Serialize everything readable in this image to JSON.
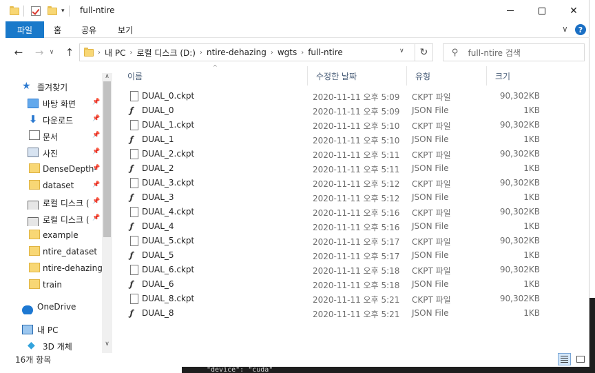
{
  "window": {
    "title": "full-ntire",
    "minimize_icon": "minimize-icon",
    "maximize_icon": "maximize-icon",
    "close_glyph": "✕"
  },
  "ribbon": {
    "tabs": [
      "파일",
      "홈",
      "공유",
      "보기"
    ],
    "expand_glyph": "∨",
    "help_glyph": "?"
  },
  "address": {
    "back_glyph": "←",
    "forward_glyph": "→",
    "recent_glyph": "∨",
    "up_glyph": "↑",
    "crumbs": [
      "내 PC",
      "로컬 디스크 (D:)",
      "ntire-dehazing",
      "wgts",
      "full-ntire"
    ],
    "sep": "›",
    "dropdown_glyph": "∨",
    "refresh_glyph": "↻"
  },
  "search": {
    "placeholder": "full-ntire 검색",
    "icon_glyph": "⚲"
  },
  "nav": {
    "items": [
      {
        "label": "즐겨찾기",
        "icon": "star-icon"
      },
      {
        "label": "바탕 화면",
        "icon": "desktop-icon",
        "pinned": true
      },
      {
        "label": "다운로드",
        "icon": "download-icon",
        "pinned": true
      },
      {
        "label": "문서",
        "icon": "document-icon",
        "pinned": true
      },
      {
        "label": "사진",
        "icon": "pictures-icon",
        "pinned": true
      },
      {
        "label": "DenseDepth-",
        "icon": "folder-icon",
        "pinned": true
      },
      {
        "label": "dataset",
        "icon": "folder-icon",
        "pinned": true
      },
      {
        "label": "로컬 디스크 (",
        "icon": "drive-icon",
        "pinned": true
      },
      {
        "label": "로컬 디스크 (",
        "icon": "drive-icon",
        "pinned": true
      },
      {
        "label": "example",
        "icon": "folder-icon"
      },
      {
        "label": "ntire_dataset",
        "icon": "folder-icon"
      },
      {
        "label": "ntire-dehazing",
        "icon": "folder-icon"
      },
      {
        "label": "train",
        "icon": "folder-icon"
      },
      {
        "label": "OneDrive",
        "icon": "cloud-icon"
      },
      {
        "label": "내 PC",
        "icon": "computer-icon"
      },
      {
        "label": "3D 개체",
        "icon": "cube-icon"
      }
    ],
    "pin_glyph": "📌",
    "scroll_up_glyph": "∧",
    "scroll_down_glyph": "∨"
  },
  "columns": {
    "name": "이름",
    "date": "수정한 날짜",
    "type": "유형",
    "size": "크기",
    "sort_glyph": "^"
  },
  "files": [
    {
      "name": "DUAL_0.ckpt",
      "date": "2020-11-11 오후 5:09",
      "type": "CKPT 파일",
      "size": "90,302KB",
      "icon": "file-icon"
    },
    {
      "name": "DUAL_0",
      "date": "2020-11-11 오후 5:09",
      "type": "JSON File",
      "size": "1KB",
      "icon": "json-file-icon"
    },
    {
      "name": "DUAL_1.ckpt",
      "date": "2020-11-11 오후 5:10",
      "type": "CKPT 파일",
      "size": "90,302KB",
      "icon": "file-icon"
    },
    {
      "name": "DUAL_1",
      "date": "2020-11-11 오후 5:10",
      "type": "JSON File",
      "size": "1KB",
      "icon": "json-file-icon"
    },
    {
      "name": "DUAL_2.ckpt",
      "date": "2020-11-11 오후 5:11",
      "type": "CKPT 파일",
      "size": "90,302KB",
      "icon": "file-icon"
    },
    {
      "name": "DUAL_2",
      "date": "2020-11-11 오후 5:11",
      "type": "JSON File",
      "size": "1KB",
      "icon": "json-file-icon"
    },
    {
      "name": "DUAL_3.ckpt",
      "date": "2020-11-11 오후 5:12",
      "type": "CKPT 파일",
      "size": "90,302KB",
      "icon": "file-icon"
    },
    {
      "name": "DUAL_3",
      "date": "2020-11-11 오후 5:12",
      "type": "JSON File",
      "size": "1KB",
      "icon": "json-file-icon"
    },
    {
      "name": "DUAL_4.ckpt",
      "date": "2020-11-11 오후 5:16",
      "type": "CKPT 파일",
      "size": "90,302KB",
      "icon": "file-icon"
    },
    {
      "name": "DUAL_4",
      "date": "2020-11-11 오후 5:16",
      "type": "JSON File",
      "size": "1KB",
      "icon": "json-file-icon"
    },
    {
      "name": "DUAL_5.ckpt",
      "date": "2020-11-11 오후 5:17",
      "type": "CKPT 파일",
      "size": "90,302KB",
      "icon": "file-icon"
    },
    {
      "name": "DUAL_5",
      "date": "2020-11-11 오후 5:17",
      "type": "JSON File",
      "size": "1KB",
      "icon": "json-file-icon"
    },
    {
      "name": "DUAL_6.ckpt",
      "date": "2020-11-11 오후 5:18",
      "type": "CKPT 파일",
      "size": "90,302KB",
      "icon": "file-icon"
    },
    {
      "name": "DUAL_6",
      "date": "2020-11-11 오후 5:18",
      "type": "JSON File",
      "size": "1KB",
      "icon": "json-file-icon"
    },
    {
      "name": "DUAL_8.ckpt",
      "date": "2020-11-11 오후 5:21",
      "type": "CKPT 파일",
      "size": "90,302KB",
      "icon": "file-icon"
    },
    {
      "name": "DUAL_8",
      "date": "2020-11-11 오후 5:21",
      "type": "JSON File",
      "size": "1KB",
      "icon": "json-file-icon"
    }
  ],
  "status": {
    "item_count": "16개 항목"
  },
  "background": {
    "code_text": "\"device\": \"cuda\""
  },
  "colors": {
    "file_tab": "#1979ca",
    "accent": "#1a6fc4"
  }
}
